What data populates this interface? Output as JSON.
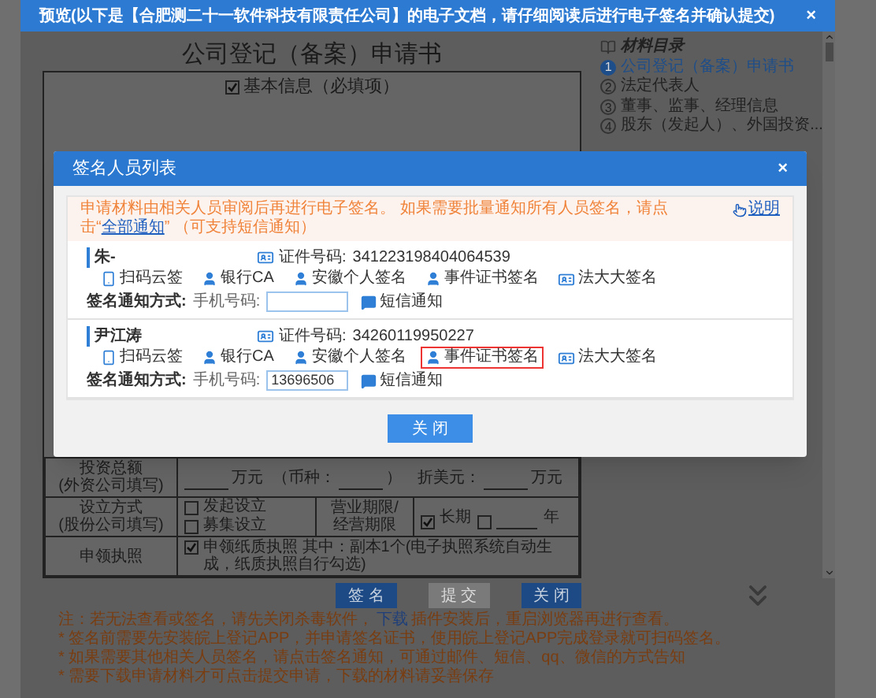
{
  "window": {
    "title": "预览(以下是【合肥测二十一软件科技有限责任公司】的电子文档，请仔细阅读后进行电子签名并确认提交)",
    "close": "×"
  },
  "document": {
    "title": "公司登记（备案）申请书",
    "section": {
      "label": "基本信息（必填项）",
      "checked": true
    },
    "table": [
      {
        "kind": "amount",
        "label": [
          "投资总额",
          "(外资公司填写)"
        ],
        "unit": "万元",
        "currency_open": "（币种：",
        "currency_close": "）",
        "usd_label": "折美元：",
        "usd_unit": "万元"
      },
      {
        "kind": "options",
        "label": [
          "设立方式",
          "(股份公司填写)"
        ],
        "options": [
          {
            "label": "发起设立",
            "checked": false
          },
          {
            "label": "募集设立",
            "checked": false
          }
        ],
        "term_label": [
          "营业期限/",
          "经营期限"
        ],
        "term_options": [
          {
            "kind": "label",
            "label": "长期",
            "checked": true
          },
          {
            "kind": "blank",
            "label": "年",
            "checked": false
          }
        ]
      },
      {
        "kind": "license",
        "label": [
          "申领执照"
        ],
        "option": {
          "label": "申领纸质执照 其中：副本1个(电子执照系统自动生成，纸质执照自行勾选)",
          "checked": true
        }
      }
    ]
  },
  "toc": {
    "title": "材料目录",
    "items": [
      {
        "number": "1",
        "label": "公司登记（备案）申请书",
        "selected": true
      },
      {
        "number": "2",
        "label": "法定代表人",
        "selected": false
      },
      {
        "number": "3",
        "label": "董事、监事、经理信息",
        "selected": false
      },
      {
        "number": "4",
        "label": "股东（发起人）、外国投资...",
        "selected": false
      }
    ]
  },
  "actions": [
    {
      "label": "签 名",
      "disabled": false
    },
    {
      "label": "提 交",
      "disabled": true
    },
    {
      "label": "关 闭",
      "disabled": false
    }
  ],
  "notes": [
    {
      "before": "注：若无法查看或签名，请先关闭杀毒软件，",
      "link": "下载",
      "after": "插件安装后，重启浏览器再进行查看。"
    },
    {
      "before": "* 签名前需要先安装皖上登记APP，并申请签名证书，使用皖上登记APP完成登录就可扫码签名。"
    },
    {
      "before": "* 如果需要其他相关人员签名，请点击签名通知，可通过邮件、短信、qq、微信的方式告知"
    },
    {
      "before": "* 需要下载申请材料才可点击提交申请，下载的材料请妥善保存"
    }
  ],
  "dialog": {
    "title": "签名人员列表",
    "close": "×",
    "notice": {
      "before": "申请材料由相关人员审阅后再进行电子签名。 如果需要批量通知所有人员签名，请点击“",
      "link": "全部通知",
      "after": "” （可支持短信通知）",
      "help": "说明"
    },
    "signers": [
      {
        "name": "朱-",
        "id_label": "证件号码:",
        "id_number": "341223198404064539",
        "methods": [
          {
            "kind": "phone",
            "label": "扫码云签",
            "highlighted": false
          },
          {
            "kind": "person",
            "label": "银行CA",
            "highlighted": false
          },
          {
            "kind": "person",
            "label": "安徽个人签名",
            "highlighted": false
          },
          {
            "kind": "person",
            "label": "事件证书签名",
            "highlighted": false
          },
          {
            "kind": "card",
            "label": "法大大签名",
            "highlighted": false
          }
        ],
        "notify_label": "签名通知方式:",
        "phone_label": "手机号码:",
        "sms": "短信通知"
      },
      {
        "name": "尹江涛",
        "id_label": "证件号码:",
        "id_number": "34260119950227",
        "methods": [
          {
            "kind": "phone",
            "label": "扫码云签",
            "highlighted": false
          },
          {
            "kind": "person",
            "label": "银行CA",
            "highlighted": false
          },
          {
            "kind": "person",
            "label": "安徽个人签名",
            "highlighted": false
          },
          {
            "kind": "person",
            "label": "事件证书签名",
            "highlighted": true
          },
          {
            "kind": "card",
            "label": "法大大签名",
            "highlighted": false
          }
        ],
        "notify_label": "签名通知方式:",
        "phone_label": "手机号码:",
        "phone": "13696506",
        "sms": "短信通知"
      }
    ],
    "close_button": "关 闭"
  }
}
